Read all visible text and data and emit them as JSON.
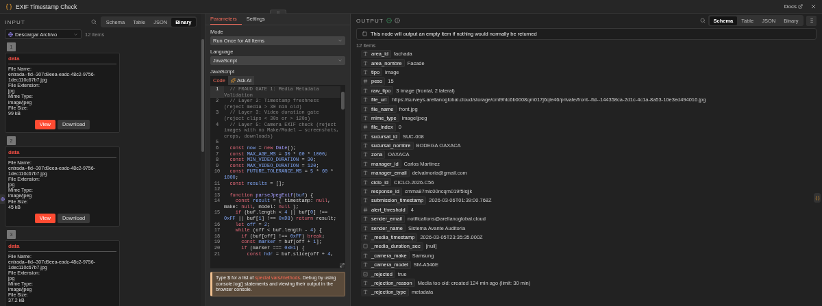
{
  "window": {
    "title": "EXIF Timestamp Check",
    "docs_link": "Docs"
  },
  "input": {
    "label": "INPUT",
    "view_tabs": [
      {
        "label": "Schema",
        "selected": false
      },
      {
        "label": "Table",
        "selected": false
      },
      {
        "label": "JSON",
        "selected": false
      },
      {
        "label": "Binary",
        "selected": true
      }
    ],
    "source": "Descargar Archivo",
    "item_count": "12 items",
    "items": [
      {
        "number": "1",
        "title": "data",
        "fields": [
          {
            "label": "File Name:",
            "value": "entrada--fid--307d9eea-eadc-48c2-9756-1dec110c67b7.jpg"
          },
          {
            "label": "File Extension:",
            "value": "jpg"
          },
          {
            "label": "Mime Type:",
            "value": "image/jpeg"
          },
          {
            "label": "File Size:",
            "value": "99 kB"
          }
        ],
        "buttons": [
          {
            "label": "View",
            "kind": "primary"
          },
          {
            "label": "Download",
            "kind": "secondary"
          }
        ]
      },
      {
        "number": "2",
        "title": "data",
        "fields": [
          {
            "label": "File Name:",
            "value": "entrada--fid--307d9eea-eadc-48c2-9756-1dec110c67b7.jpg"
          },
          {
            "label": "File Extension:",
            "value": "jpg"
          },
          {
            "label": "Mime Type:",
            "value": "image/jpeg"
          },
          {
            "label": "File Size:",
            "value": "45 kB"
          }
        ],
        "buttons": [
          {
            "label": "View",
            "kind": "primary"
          },
          {
            "label": "Download",
            "kind": "secondary"
          }
        ]
      },
      {
        "number": "3",
        "title": "data",
        "fields": [
          {
            "label": "File Name:",
            "value": "entrada--fid--307d9eea-eadc-48c2-9756-1dec110c67b7.jpg"
          },
          {
            "label": "File Extension:",
            "value": "jpg"
          },
          {
            "label": "Mime Type:",
            "value": "image/jpeg"
          },
          {
            "label": "File Size:",
            "value": "37.2 kB"
          }
        ]
      }
    ]
  },
  "parameters": {
    "tabs": [
      {
        "label": "Parameters",
        "selected": true
      },
      {
        "label": "Settings",
        "selected": false
      }
    ],
    "fields": [
      {
        "label": "Mode",
        "value": "Run Once for All Items"
      },
      {
        "label": "Language",
        "value": "JavaScript"
      }
    ],
    "code": {
      "label": "JavaScript",
      "tabs": [
        {
          "label": "Code",
          "selected": true
        },
        {
          "label": "Ask AI",
          "selected": false
        }
      ],
      "lines": [
        {
          "number": "1",
          "active": true,
          "segments": [
            {
              "kind": "comment",
              "text": "  // FRAUD GATE 1: Media Metadata Validation"
            }
          ]
        },
        {
          "number": "2",
          "active": false,
          "segments": [
            {
              "kind": "comment",
              "text": "  // Layer 2: Timestamp freshness (reject media > 30 min old)"
            }
          ]
        },
        {
          "number": "3",
          "active": false,
          "segments": [
            {
              "kind": "comment",
              "text": "  // Layer 3: Video duration gate (reject clips < 30s or > 120s)"
            }
          ]
        },
        {
          "number": "4",
          "active": false,
          "segments": [
            {
              "kind": "comment",
              "text": "  // Layer 5: Camera EXIF check (reject images with no Make/Model — screenshots, crops, downloads)"
            }
          ]
        },
        {
          "number": "5",
          "active": false
        },
        {
          "number": "6",
          "active": false,
          "segments": [
            {
              "kind": "keyword",
              "text": "  const "
            },
            {
              "kind": "variable",
              "text": "now"
            },
            {
              "kind": "plain",
              "text": " = "
            },
            {
              "kind": "keyword",
              "text": "new "
            },
            {
              "kind": "func",
              "text": "Date"
            },
            {
              "kind": "plain",
              "text": "();"
            }
          ]
        },
        {
          "number": "7",
          "active": false,
          "segments": [
            {
              "kind": "keyword",
              "text": "  const "
            },
            {
              "kind": "variable",
              "text": "MAX_AGE_MS"
            },
            {
              "kind": "plain",
              "text": " = "
            },
            {
              "kind": "number",
              "text": "30"
            },
            {
              "kind": "plain",
              "text": " * "
            },
            {
              "kind": "number",
              "text": "60"
            },
            {
              "kind": "plain",
              "text": " * "
            },
            {
              "kind": "number",
              "text": "1000"
            },
            {
              "kind": "plain",
              "text": ";"
            }
          ]
        },
        {
          "number": "8",
          "active": false,
          "segments": [
            {
              "kind": "keyword",
              "text": "  const "
            },
            {
              "kind": "variable",
              "text": "MIN_VIDEO_DURATION"
            },
            {
              "kind": "plain",
              "text": " = "
            },
            {
              "kind": "number",
              "text": "30"
            },
            {
              "kind": "plain",
              "text": ";"
            }
          ]
        },
        {
          "number": "9",
          "active": false,
          "segments": [
            {
              "kind": "keyword",
              "text": "  const "
            },
            {
              "kind": "variable",
              "text": "MAX_VIDEO_DURATION"
            },
            {
              "kind": "plain",
              "text": " = "
            },
            {
              "kind": "number",
              "text": "120"
            },
            {
              "kind": "plain",
              "text": ";"
            }
          ]
        },
        {
          "number": "10",
          "active": false,
          "segments": [
            {
              "kind": "keyword",
              "text": "  const "
            },
            {
              "kind": "variable",
              "text": "FUTURE_TOLERANCE_MS"
            },
            {
              "kind": "plain",
              "text": " = "
            },
            {
              "kind": "number",
              "text": "5"
            },
            {
              "kind": "plain",
              "text": " * "
            },
            {
              "kind": "number",
              "text": "60"
            },
            {
              "kind": "plain",
              "text": " * "
            },
            {
              "kind": "number",
              "text": "1000"
            },
            {
              "kind": "plain",
              "text": ";"
            }
          ]
        },
        {
          "number": "11",
          "active": false,
          "segments": [
            {
              "kind": "keyword",
              "text": "  const "
            },
            {
              "kind": "variable",
              "text": "results"
            },
            {
              "kind": "plain",
              "text": " = [];"
            }
          ]
        },
        {
          "number": "12",
          "active": false
        },
        {
          "number": "13",
          "active": false,
          "segments": [
            {
              "kind": "keyword",
              "text": "  function "
            },
            {
              "kind": "func",
              "text": "parseJpegExif"
            },
            {
              "kind": "plain",
              "text": "("
            },
            {
              "kind": "variable",
              "text": "buf"
            },
            {
              "kind": "plain",
              "text": ") {"
            }
          ]
        },
        {
          "number": "14",
          "active": false,
          "segments": [
            {
              "kind": "keyword",
              "text": "    const "
            },
            {
              "kind": "variable",
              "text": "result"
            },
            {
              "kind": "plain",
              "text": " = { timestamp: "
            },
            {
              "kind": "literal",
              "text": "null"
            },
            {
              "kind": "plain",
              "text": ", make: "
            },
            {
              "kind": "literal",
              "text": "null"
            },
            {
              "kind": "plain",
              "text": ", model: "
            },
            {
              "kind": "literal",
              "text": "null"
            },
            {
              "kind": "plain",
              "text": " };"
            }
          ]
        },
        {
          "number": "15",
          "active": false,
          "segments": [
            {
              "kind": "keyword",
              "text": "    if "
            },
            {
              "kind": "plain",
              "text": "(buf.length < "
            },
            {
              "kind": "number",
              "text": "4"
            },
            {
              "kind": "plain",
              "text": " || buf["
            },
            {
              "kind": "number",
              "text": "0"
            },
            {
              "kind": "plain",
              "text": "] !== "
            },
            {
              "kind": "number",
              "text": "0xFF"
            },
            {
              "kind": "plain",
              "text": " || buf["
            },
            {
              "kind": "number",
              "text": "1"
            },
            {
              "kind": "plain",
              "text": "] !== "
            },
            {
              "kind": "number",
              "text": "0xD8"
            },
            {
              "kind": "plain",
              "text": ") "
            },
            {
              "kind": "keyword",
              "text": "return "
            },
            {
              "kind": "plain",
              "text": "result;"
            }
          ]
        },
        {
          "number": "16",
          "active": false,
          "segments": [
            {
              "kind": "keyword",
              "text": "    let "
            },
            {
              "kind": "variable",
              "text": "off"
            },
            {
              "kind": "plain",
              "text": " = "
            },
            {
              "kind": "number",
              "text": "2"
            },
            {
              "kind": "plain",
              "text": ";"
            }
          ]
        },
        {
          "number": "17",
          "active": false,
          "segments": [
            {
              "kind": "keyword",
              "text": "    while "
            },
            {
              "kind": "plain",
              "text": "(off < buf.length - "
            },
            {
              "kind": "number",
              "text": "4"
            },
            {
              "kind": "plain",
              "text": ") {"
            }
          ]
        },
        {
          "number": "18",
          "active": false,
          "segments": [
            {
              "kind": "keyword",
              "text": "      if "
            },
            {
              "kind": "plain",
              "text": "(buf[off] !== "
            },
            {
              "kind": "number",
              "text": "0xFF"
            },
            {
              "kind": "plain",
              "text": ") "
            },
            {
              "kind": "keyword",
              "text": "break"
            },
            {
              "kind": "plain",
              "text": ";"
            }
          ]
        },
        {
          "number": "19",
          "active": false,
          "segments": [
            {
              "kind": "keyword",
              "text": "      const "
            },
            {
              "kind": "variable",
              "text": "marker"
            },
            {
              "kind": "plain",
              "text": " = buf[off + "
            },
            {
              "kind": "number",
              "text": "1"
            },
            {
              "kind": "plain",
              "text": "];"
            }
          ]
        },
        {
          "number": "20",
          "active": false,
          "segments": [
            {
              "kind": "keyword",
              "text": "      if "
            },
            {
              "kind": "plain",
              "text": "(marker === "
            },
            {
              "kind": "number",
              "text": "0xE1"
            },
            {
              "kind": "plain",
              "text": ") {"
            }
          ]
        },
        {
          "number": "21",
          "active": false,
          "segments": [
            {
              "kind": "keyword",
              "text": "        const "
            },
            {
              "kind": "variable",
              "text": "hdr"
            },
            {
              "kind": "plain",
              "text": " = buf.slice(off + "
            },
            {
              "kind": "number",
              "text": "4"
            },
            {
              "kind": "plain",
              "text": ","
            }
          ]
        }
      ]
    },
    "hint": {
      "before": "Type $ for a list of ",
      "link": "special vars/methods",
      "after": ". Debug by using console.log() statements and viewing their output in the browser console."
    }
  },
  "output": {
    "label": "OUTPUT",
    "view_tabs": [
      {
        "label": "Schema",
        "selected": true
      },
      {
        "label": "Table",
        "selected": false
      },
      {
        "label": "JSON",
        "selected": false
      },
      {
        "label": "Binary",
        "selected": false
      }
    ],
    "notice": "This node will output an empty item if nothing would normally be returned",
    "item_count": "12 items",
    "fields": [
      {
        "kind": "string",
        "key": "area_id",
        "value": "fachada"
      },
      {
        "kind": "string",
        "key": "area_nombre",
        "value": "Facade"
      },
      {
        "kind": "string",
        "key": "tipo",
        "value": "image"
      },
      {
        "kind": "number",
        "key": "peso",
        "value": "15"
      },
      {
        "kind": "string",
        "key": "raw_tipo",
        "value": "3 image (frontal, 2 lateral)"
      },
      {
        "kind": "string",
        "key": "file_url",
        "value": "https://surveys.arellanoglobal.cloud/storage/cml9htc6b0008qm017j6qle46/private/front--fid--144358ca-2d1c-4c1a-8a53-10e3ed494016.jpg"
      },
      {
        "kind": "string",
        "key": "file_name",
        "value": "front.jpg"
      },
      {
        "kind": "string",
        "key": "mime_type",
        "value": "image/jpeg"
      },
      {
        "kind": "number",
        "key": "file_index",
        "value": "0"
      },
      {
        "kind": "string",
        "key": "sucursal_id",
        "value": "SUC-008"
      },
      {
        "kind": "string",
        "key": "sucursal_nombre",
        "value": "BODEGA OAXACA"
      },
      {
        "kind": "string",
        "key": "zona",
        "value": "OAXACA"
      },
      {
        "kind": "string",
        "key": "manager_id",
        "value": "Carlos Martinez"
      },
      {
        "kind": "string",
        "key": "manager_email",
        "value": "delvalmoria@gmail.com"
      },
      {
        "kind": "string",
        "key": "ciclo_id",
        "value": "CICLO-2026-C56"
      },
      {
        "kind": "string",
        "key": "response_id",
        "value": "cmma87mlc00ncqm019f5lsjjk"
      },
      {
        "kind": "string",
        "key": "submission_timestamp",
        "value": "2026-03-06T01:39:00.768Z"
      },
      {
        "kind": "number",
        "key": "alert_threshold",
        "value": "4"
      },
      {
        "kind": "string",
        "key": "sender_email",
        "value": "notifications@arellanoglobal.cloud"
      },
      {
        "kind": "string",
        "key": "sender_name",
        "value": "Sistema Avante Auditoria"
      },
      {
        "kind": "string",
        "key": "_media_timestamp",
        "value": "2026-03-05T23:35:35.000Z"
      },
      {
        "kind": "null",
        "key": "_media_duration_sec",
        "value": "[null]"
      },
      {
        "kind": "string",
        "key": "_camera_make",
        "value": "Samsung"
      },
      {
        "kind": "string",
        "key": "_camera_model",
        "value": "SM-A546E"
      },
      {
        "kind": "boolean",
        "key": "_rejected",
        "value": "true"
      },
      {
        "kind": "string",
        "key": "_rejection_reason",
        "value": "Media too old: created 124 min ago (limit: 30 min)"
      },
      {
        "kind": "string",
        "key": "_rejection_type",
        "value": "metadata"
      }
    ]
  }
}
